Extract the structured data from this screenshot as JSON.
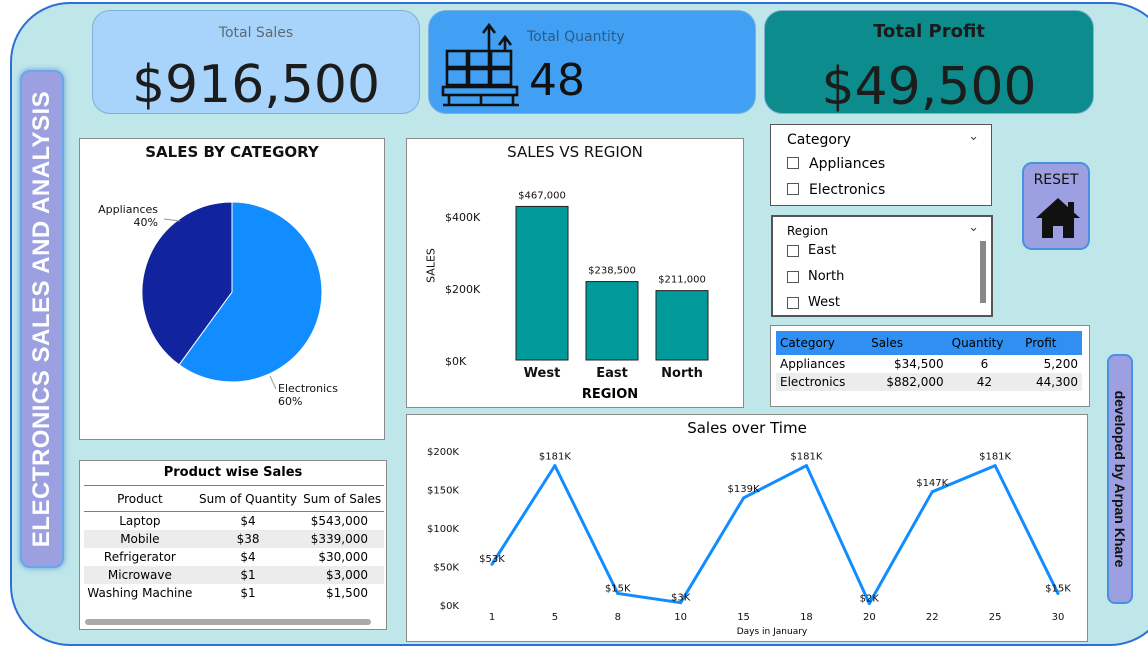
{
  "side_title": "ELECTRONICS SALES AND ANALYSIS",
  "kpis": {
    "total_sales": {
      "label": "Total Sales",
      "value": "$916,500"
    },
    "total_quantity": {
      "label": "Total Quantity",
      "value": "48"
    },
    "total_profit": {
      "label": "Total Profit",
      "value": "$49,500"
    }
  },
  "pie": {
    "title": "SALES BY CATEGORY",
    "slices": [
      {
        "label": "Electronics",
        "pct_label": "60%",
        "value": 60,
        "color": "#118dff"
      },
      {
        "label": "Appliances",
        "pct_label": "40%",
        "value": 40,
        "color": "#12239e"
      }
    ]
  },
  "region_chart": {
    "title": "SALES VS REGION",
    "xlabel": "REGION",
    "ylabel": "SALES",
    "y_ticks": [
      "$0K",
      "$200K",
      "$400K"
    ],
    "bar_color": "#009a9a"
  },
  "slicers": {
    "category": {
      "title": "Category",
      "options": [
        "Appliances",
        "Electronics"
      ]
    },
    "region": {
      "title": "Region",
      "options": [
        "East",
        "North",
        "West"
      ]
    }
  },
  "reset": {
    "label": "RESET"
  },
  "summary_table": {
    "headers": [
      "Category",
      "Sales",
      "Quantity",
      "Profit"
    ],
    "rows": [
      [
        "Appliances",
        "$34,500",
        "6",
        "5,200"
      ],
      [
        "Electronics",
        "$882,000",
        "42",
        "44,300"
      ]
    ]
  },
  "product_table": {
    "title": "Product wise Sales",
    "headers": [
      "Product",
      "Sum of Quantity",
      "Sum of Sales"
    ],
    "rows": [
      [
        "Laptop",
        "$4",
        "$543,000"
      ],
      [
        "Mobile",
        "$38",
        "$339,000"
      ],
      [
        "Refrigerator",
        "$4",
        "$30,000"
      ],
      [
        "Microwave",
        "$1",
        "$3,000"
      ],
      [
        "Washing Machine",
        "$1",
        "$1,500"
      ]
    ]
  },
  "time_chart": {
    "title": "Sales over Time",
    "xlabel": "Days in January",
    "y_ticks": [
      "$0K",
      "$50K",
      "$100K",
      "$150K",
      "$200K"
    ],
    "line_color": "#118dff"
  },
  "developer": "developed by Arpan Khare",
  "chart_data": [
    {
      "type": "pie",
      "title": "SALES BY CATEGORY",
      "categories": [
        "Electronics",
        "Appliances"
      ],
      "values": [
        60,
        40
      ]
    },
    {
      "type": "bar",
      "title": "SALES VS REGION",
      "xlabel": "REGION",
      "ylabel": "SALES",
      "categories": [
        "West",
        "East",
        "North"
      ],
      "values": [
        467000,
        238500,
        211000
      ],
      "data_labels": [
        "$467,000",
        "$238,500",
        "$211,000"
      ],
      "ylim": [
        0,
        520000
      ]
    },
    {
      "type": "line",
      "title": "Sales over Time",
      "xlabel": "Days in January",
      "ylabel": "",
      "x": [
        1,
        5,
        8,
        10,
        15,
        18,
        20,
        22,
        25,
        30
      ],
      "values": [
        53000,
        181000,
        15000,
        3000,
        139000,
        181000,
        2000,
        147000,
        181000,
        15000
      ],
      "data_labels": [
        "$53K",
        "$181K",
        "$15K",
        "$3K",
        "$139K",
        "$181K",
        "$2K",
        "$147K",
        "$181K",
        "$15K"
      ],
      "ylim": [
        0,
        200000
      ]
    }
  ]
}
